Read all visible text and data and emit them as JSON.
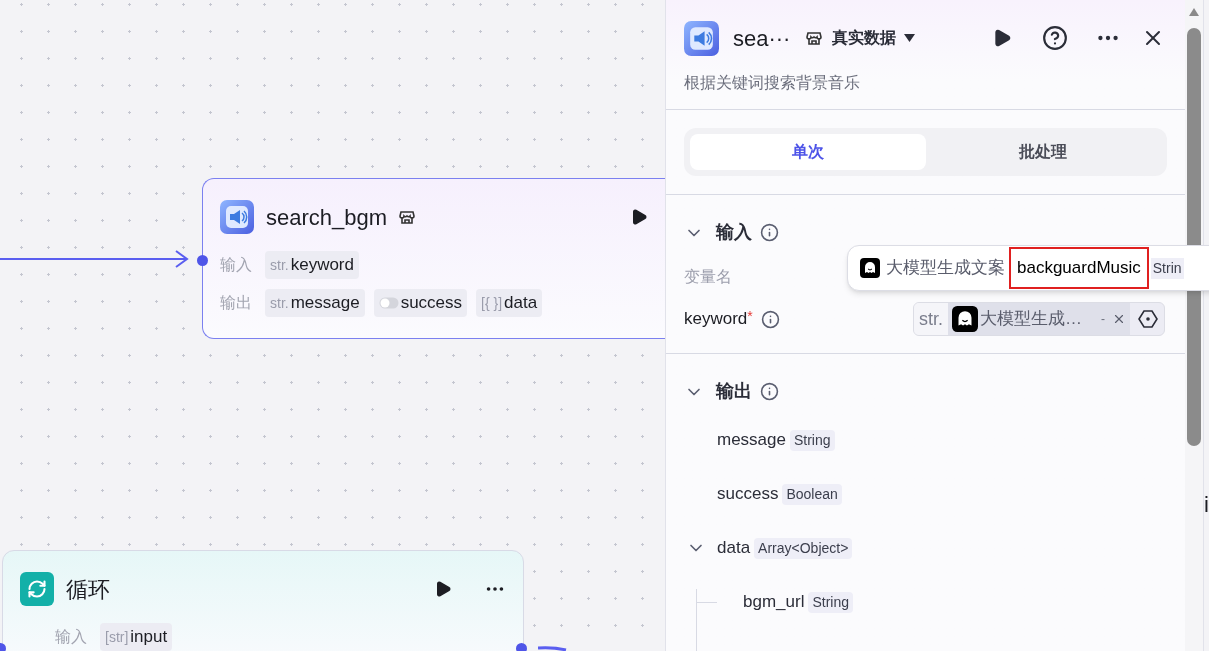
{
  "canvas": {
    "nodes": [
      {
        "kind": "plugin",
        "title": "search_bgm",
        "rows": [
          {
            "label": "输入",
            "ports": [
              {
                "kind": "string",
                "type": "str.",
                "name": "keyword"
              }
            ]
          },
          {
            "label": "输出",
            "ports": [
              {
                "kind": "string",
                "type": "str.",
                "name": "message"
              },
              {
                "kind": "boolean",
                "name": "success"
              },
              {
                "kind": "array",
                "type": "[{ }]",
                "name": "data"
              }
            ]
          }
        ]
      },
      {
        "kind": "loop",
        "title": "循环",
        "rows": [
          {
            "label": "输入",
            "ports": [
              {
                "kind": "array",
                "type": "[str]",
                "name": "input"
              }
            ]
          }
        ]
      }
    ],
    "edge_text": "i"
  },
  "panel": {
    "title": "sea···",
    "mode": "真实数据",
    "description": "根据关键词搜索背景音乐",
    "tabs": [
      {
        "label": "单次",
        "selected": true
      },
      {
        "label": "批处理",
        "selected": false
      }
    ],
    "inputs": {
      "title": "输入",
      "expanded": true,
      "column": "变量名",
      "params": [
        {
          "name": "keyword",
          "required_mark": "*",
          "type": "str.",
          "ref": "大模型生成…",
          "ref_dash": "-"
        }
      ]
    },
    "outputs": {
      "title": "输出",
      "expanded": true,
      "items": [
        {
          "name": "message",
          "type": "String"
        },
        {
          "name": "success",
          "type": "Boolean"
        },
        {
          "name": "data",
          "type": "Array<Object>",
          "expanded": true,
          "children": [
            {
              "name": "bgm_url",
              "type": "String"
            }
          ]
        }
      ]
    },
    "popover": {
      "source": "大模型生成文案",
      "variable": "backguardMusic",
      "highlighted": true,
      "type": "Strin"
    }
  }
}
